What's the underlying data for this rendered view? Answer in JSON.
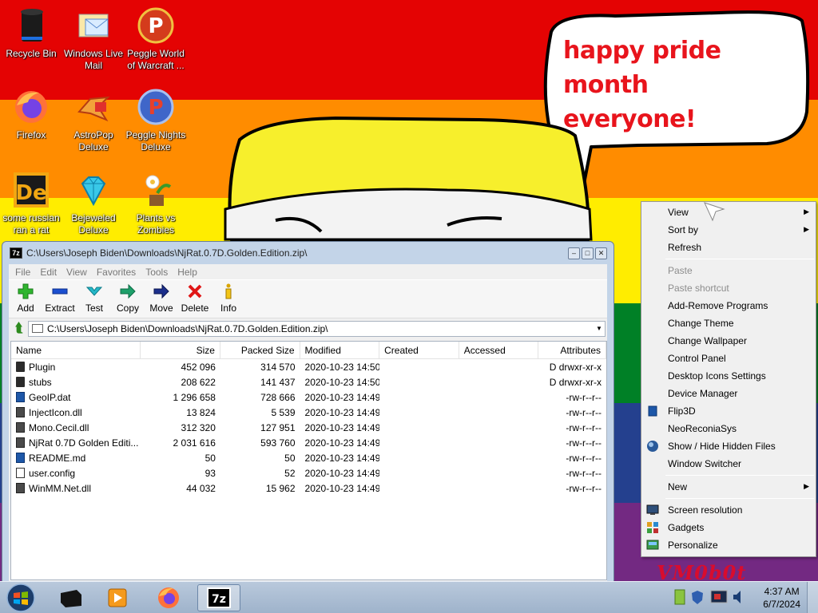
{
  "wallpaper": {
    "stripes": [
      "#e40303",
      "#ff8c00",
      "#ffed00",
      "#008026",
      "#24408e",
      "#732982"
    ],
    "speech_bubble_line1": "happy pride month",
    "speech_bubble_line2": "everyone!",
    "watermark": "VM0b0t"
  },
  "desktop_icons": [
    {
      "label": "Recycle Bin",
      "icon": "recycle-bin-icon"
    },
    {
      "label": "Windows Live Mail",
      "icon": "mail-icon"
    },
    {
      "label": "Peggle World of Warcraft ...",
      "icon": "peggle-icon"
    },
    {
      "label": "Firefox",
      "icon": "firefox-icon"
    },
    {
      "label": "AstroPop Deluxe",
      "icon": "astropop-icon"
    },
    {
      "label": "Peggle Nights Deluxe",
      "icon": "peggle-nights-icon"
    },
    {
      "label": "some russian ran a rat",
      "icon": "de-icon"
    },
    {
      "label": "Bejeweled Deluxe",
      "icon": "gem-icon"
    },
    {
      "label": "Plants vs Zombies",
      "icon": "plant-icon"
    }
  ],
  "window": {
    "title": "C:\\Users\\Joseph Biden\\Downloads\\NjRat.0.7D.Golden.Edition.zip\\",
    "menu": [
      "File",
      "Edit",
      "View",
      "Favorites",
      "Tools",
      "Help"
    ],
    "toolbar": [
      "Add",
      "Extract",
      "Test",
      "Copy",
      "Move",
      "Delete",
      "Info"
    ],
    "address": "C:\\Users\\Joseph Biden\\Downloads\\NjRat.0.7D.Golden.Edition.zip\\",
    "columns": [
      "Name",
      "Size",
      "Packed Size",
      "Modified",
      "Created",
      "Accessed",
      "Attributes"
    ],
    "files": [
      {
        "name": "Plugin",
        "size": "452 096",
        "packed": "314 570",
        "modified": "2020-10-23 14:50",
        "created": "",
        "accessed": "",
        "attr": "D drwxr-xr-x",
        "type": "folder"
      },
      {
        "name": "stubs",
        "size": "208 622",
        "packed": "141 437",
        "modified": "2020-10-23 14:50",
        "created": "",
        "accessed": "",
        "attr": "D drwxr-xr-x",
        "type": "folder"
      },
      {
        "name": "GeoIP.dat",
        "size": "1 296 658",
        "packed": "728 666",
        "modified": "2020-10-23 14:49",
        "created": "",
        "accessed": "",
        "attr": "-rw-r--r--",
        "type": "blue"
      },
      {
        "name": "InjectIcon.dll",
        "size": "13 824",
        "packed": "5 539",
        "modified": "2020-10-23 14:49",
        "created": "",
        "accessed": "",
        "attr": "-rw-r--r--",
        "type": "dll"
      },
      {
        "name": "Mono.Cecil.dll",
        "size": "312 320",
        "packed": "127 951",
        "modified": "2020-10-23 14:49",
        "created": "",
        "accessed": "",
        "attr": "-rw-r--r--",
        "type": "dll"
      },
      {
        "name": "NjRat 0.7D Golden Editi...",
        "size": "2 031 616",
        "packed": "593 760",
        "modified": "2020-10-23 14:49",
        "created": "",
        "accessed": "",
        "attr": "-rw-r--r--",
        "type": "dll"
      },
      {
        "name": "README.md",
        "size": "50",
        "packed": "50",
        "modified": "2020-10-23 14:49",
        "created": "",
        "accessed": "",
        "attr": "-rw-r--r--",
        "type": "blue"
      },
      {
        "name": "user.config",
        "size": "93",
        "packed": "52",
        "modified": "2020-10-23 14:49",
        "created": "",
        "accessed": "",
        "attr": "-rw-r--r--",
        "type": "doc"
      },
      {
        "name": "WinMM.Net.dll",
        "size": "44 032",
        "packed": "15 962",
        "modified": "2020-10-23 14:49",
        "created": "",
        "accessed": "",
        "attr": "-rw-r--r--",
        "type": "dll"
      }
    ]
  },
  "context_menu": {
    "group1": [
      {
        "label": "View",
        "submenu": true
      },
      {
        "label": "Sort by",
        "submenu": true
      },
      {
        "label": "Refresh",
        "submenu": false
      }
    ],
    "group2": [
      {
        "label": "Paste",
        "disabled": true
      },
      {
        "label": "Paste shortcut",
        "disabled": true
      },
      {
        "label": "Add-Remove Programs",
        "disabled": false
      },
      {
        "label": "Change Theme",
        "disabled": false
      },
      {
        "label": "Change Wallpaper",
        "disabled": false
      },
      {
        "label": "Control Panel",
        "disabled": false
      },
      {
        "label": "Desktop Icons Settings",
        "disabled": false
      },
      {
        "label": "Device Manager",
        "disabled": false
      },
      {
        "label": "Flip3D",
        "disabled": false
      },
      {
        "label": "NeoReconiaSys",
        "disabled": false
      },
      {
        "label": "Show / Hide Hidden Files",
        "disabled": false
      },
      {
        "label": "Window Switcher",
        "disabled": false
      }
    ],
    "new_label": "New",
    "group3": [
      {
        "label": "Screen resolution"
      },
      {
        "label": "Gadgets"
      },
      {
        "label": "Personalize"
      }
    ]
  },
  "taskbar": {
    "time": "4:37 AM",
    "date": "6/7/2024",
    "pinned": [
      "black-box-icon",
      "media-player-icon",
      "firefox-icon",
      "7zip-icon"
    ]
  }
}
